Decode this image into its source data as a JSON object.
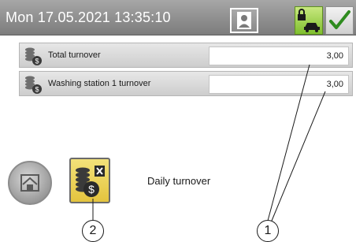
{
  "header": {
    "datetime": "Mon 17.05.2021  13:35:10",
    "user_icon": "user-icon",
    "lock_icon": "lock-car-icon",
    "check_icon": "check-icon"
  },
  "rows": [
    {
      "label": "Total turnover",
      "value": "3,00",
      "icon": "coins-icon"
    },
    {
      "label": "Washing station 1 turnover",
      "value": "3,00",
      "icon": "coins-icon"
    }
  ],
  "bottom": {
    "home_icon": "home-icon",
    "turnover_icon": "coins-delete-icon",
    "daily_label": "Daily turnover"
  },
  "callouts": {
    "one": "1",
    "two": "2"
  },
  "colors": {
    "header": "#8c8c8c",
    "accent_green": "#7fbf2e",
    "button_yellow": "#e4c43e",
    "check_green": "#2e8b1e"
  }
}
